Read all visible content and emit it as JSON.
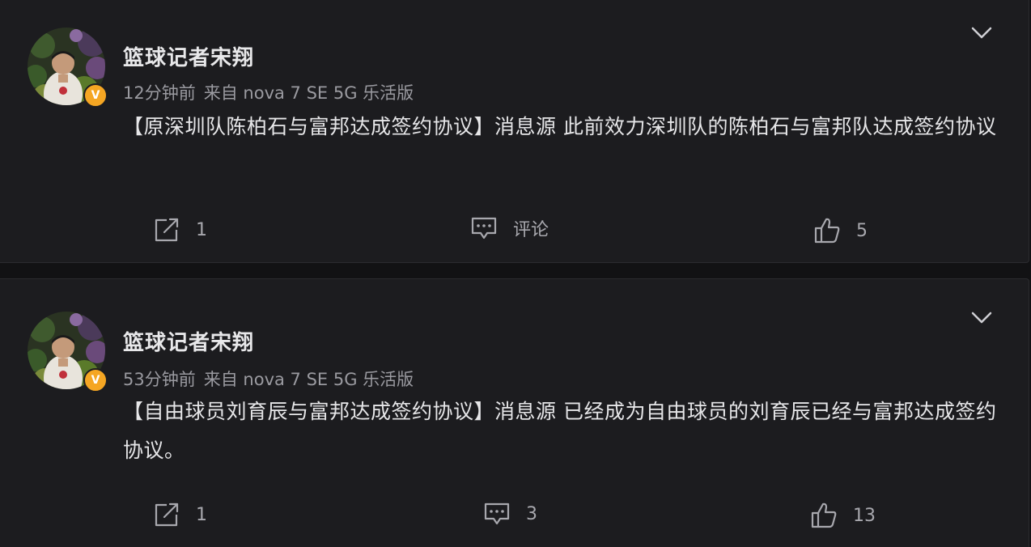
{
  "posts": [
    {
      "username": "篮球记者宋翔",
      "time": "12分钟前",
      "source": "来自 nova 7 SE 5G 乐活版",
      "verified_badge": "V",
      "content": "【原深圳队陈柏石与富邦达成签约协议】消息源 此前效力深圳队的陈柏石与富邦队达成签约协议",
      "reposts": "1",
      "comments": "评论",
      "likes": "5"
    },
    {
      "username": "篮球记者宋翔",
      "time": "53分钟前",
      "source": "来自 nova 7 SE 5G 乐活版",
      "verified_badge": "V",
      "content": "【自由球员刘育辰与富邦达成签约协议】消息源 已经成为自由球员的刘育辰已经与富邦达成签约协议。",
      "reposts": "1",
      "comments": "3",
      "likes": "13"
    }
  ],
  "icons": {
    "more": "chevron-down-icon",
    "repost": "share-icon",
    "comment": "comment-icon",
    "like": "thumbs-up-icon"
  },
  "colors": {
    "background": "#121214",
    "card": "#1c1c1f",
    "text": "#e6e6e8",
    "muted": "#9a9aa0",
    "verified": "#f5a623"
  }
}
